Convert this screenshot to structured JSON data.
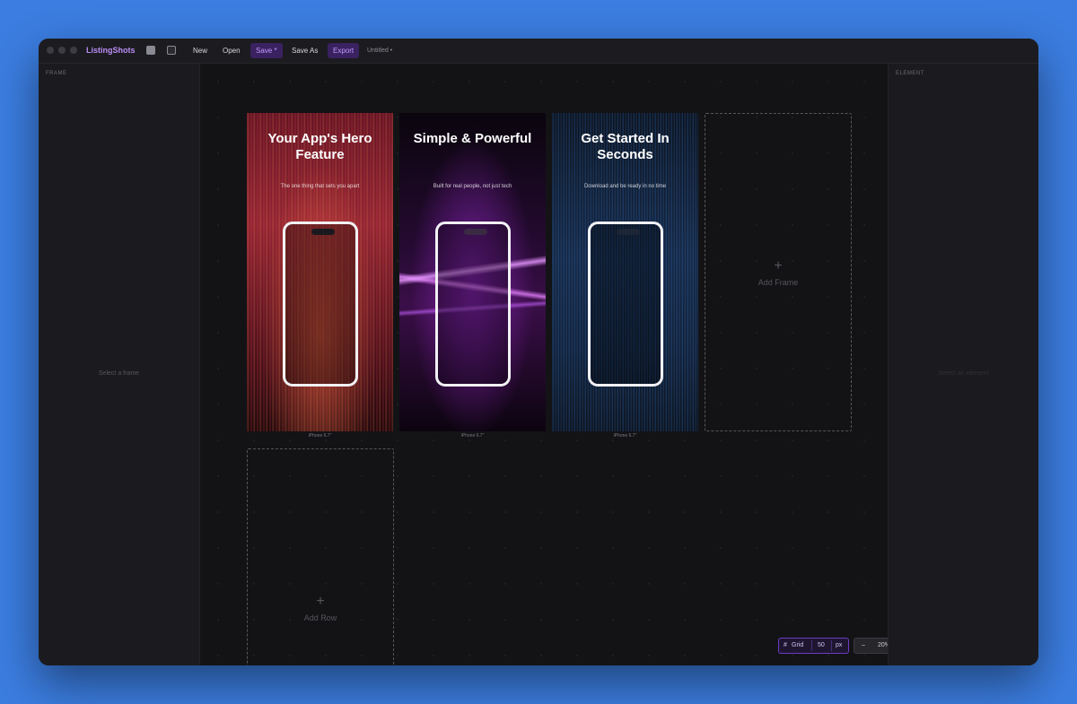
{
  "app": {
    "name": "ListingShots",
    "document_name": "Untitled •"
  },
  "toolbar": {
    "icon1": "window-icon",
    "icon2": "device-icon",
    "new_label": "New",
    "open_label": "Open",
    "save_label": "Save *",
    "save_as_label": "Save As",
    "export_label": "Export"
  },
  "left_panel": {
    "title": "FRAME",
    "empty_text": "Select a frame"
  },
  "right_panel": {
    "title": "ELEMENT",
    "empty_text": "Select an element"
  },
  "frames": [
    {
      "title": "Your App's Hero Feature",
      "subtitle": "The one thing that sets you apart",
      "device": "iPhone 6.7\"",
      "theme_color": "#8a2230"
    },
    {
      "title": "Simple & Powerful",
      "subtitle": "Built for real people, not just tech",
      "device": "iPhone 6.7\"",
      "theme_color": "#3a0e48"
    },
    {
      "title": "Get Started In Seconds",
      "subtitle": "Download and be ready in no time",
      "device": "iPhone 6.7\"",
      "theme_color": "#0f1e36"
    }
  ],
  "add_frame_label": "Add Frame",
  "add_row_label": "Add Row",
  "grid_control": {
    "label": "Grid",
    "size": "50",
    "unit": "px"
  },
  "zoom_control": {
    "minus": "–",
    "level": "20%",
    "plus": "+"
  },
  "colors": {
    "accent": "#b98cf5",
    "window_bg": "#16161a",
    "desktop_bg": "#3b7de0"
  }
}
